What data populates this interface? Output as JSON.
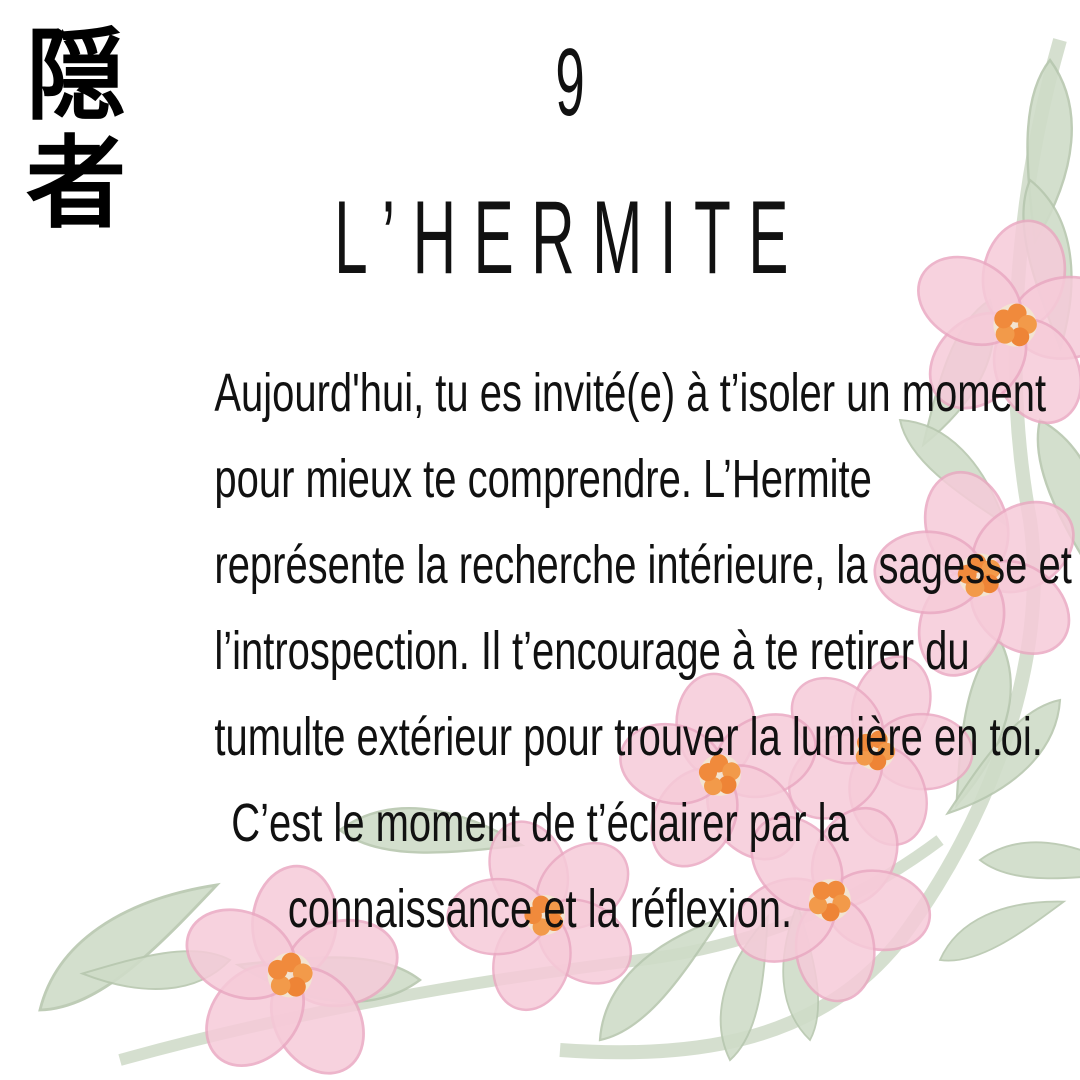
{
  "card": {
    "kanji": [
      "隠",
      "者"
    ],
    "number": "9",
    "title": "L’HERMITE",
    "text_lines": [
      "Aujourd'hui, tu es invité(e) à t’isoler un moment",
      "pour mieux te comprendre. L’Hermite",
      "représente la recherche intérieure, la sagesse et",
      "l’introspection. Il t’encourage à te retirer du",
      "tumulte extérieur pour trouver la lumière en toi.",
      "C’est le moment de t’éclairer par la",
      "connaissance et la réflexion."
    ]
  },
  "colors": {
    "background": "#ffffff",
    "text": "#111111",
    "leaf": "#c9d6c2",
    "petal": "#f3c6d6",
    "flower_center": "#f08a3c"
  }
}
